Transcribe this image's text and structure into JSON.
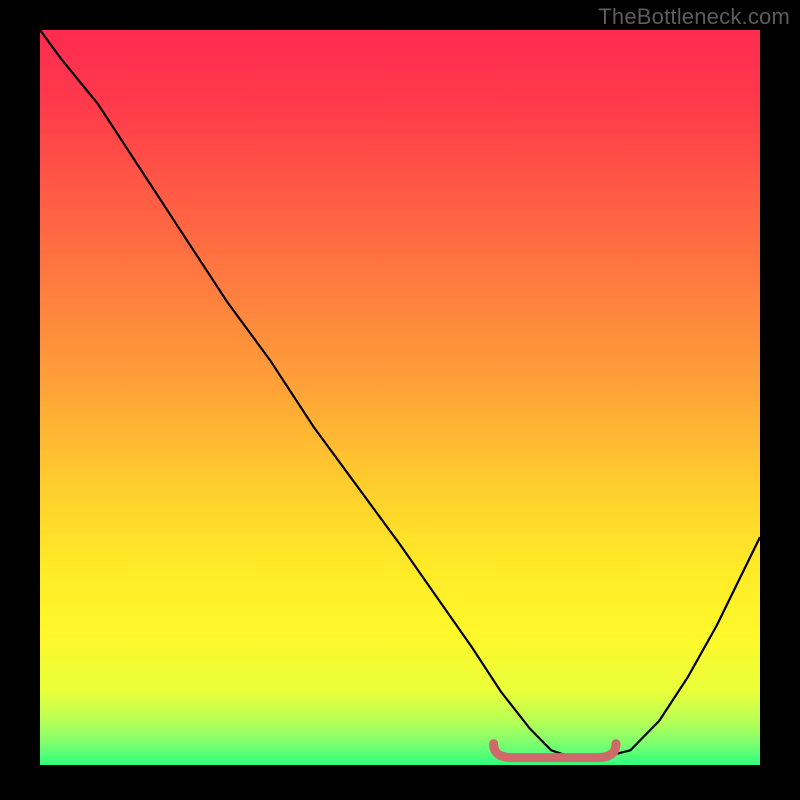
{
  "watermark": "TheBottleneck.com",
  "colors": {
    "background": "#000000",
    "curve": "#000000",
    "highlight": "#d06a6a",
    "watermark": "#5c5c5c"
  },
  "gradient_stops": [
    {
      "offset": 0.0,
      "color": "#ff2b50"
    },
    {
      "offset": 0.1,
      "color": "#ff3a4b"
    },
    {
      "offset": 0.22,
      "color": "#ff5a45"
    },
    {
      "offset": 0.35,
      "color": "#ff7d3f"
    },
    {
      "offset": 0.48,
      "color": "#ffa038"
    },
    {
      "offset": 0.6,
      "color": "#ffc82f"
    },
    {
      "offset": 0.72,
      "color": "#ffe828"
    },
    {
      "offset": 0.82,
      "color": "#fff82a"
    },
    {
      "offset": 0.9,
      "color": "#e9ff3a"
    },
    {
      "offset": 0.94,
      "color": "#b8ff56"
    },
    {
      "offset": 0.97,
      "color": "#7fff6e"
    },
    {
      "offset": 1.0,
      "color": "#2dff7f"
    }
  ],
  "chart_data": {
    "type": "line",
    "title": "",
    "xlabel": "",
    "ylabel": "",
    "xlim": [
      0,
      100
    ],
    "ylim": [
      0,
      100
    ],
    "x": [
      0,
      3,
      8,
      14,
      20,
      26,
      32,
      38,
      44,
      50,
      55,
      60,
      64,
      68,
      71,
      74,
      78,
      82,
      86,
      90,
      94,
      98,
      100
    ],
    "values": [
      100,
      96,
      90,
      81,
      72,
      63,
      55,
      46,
      38,
      30,
      23,
      16,
      10,
      5,
      2,
      1,
      1,
      2,
      6,
      12,
      19,
      27,
      31
    ],
    "highlighted_region": {
      "x_start": 63,
      "x_end": 80,
      "y": 1
    }
  }
}
